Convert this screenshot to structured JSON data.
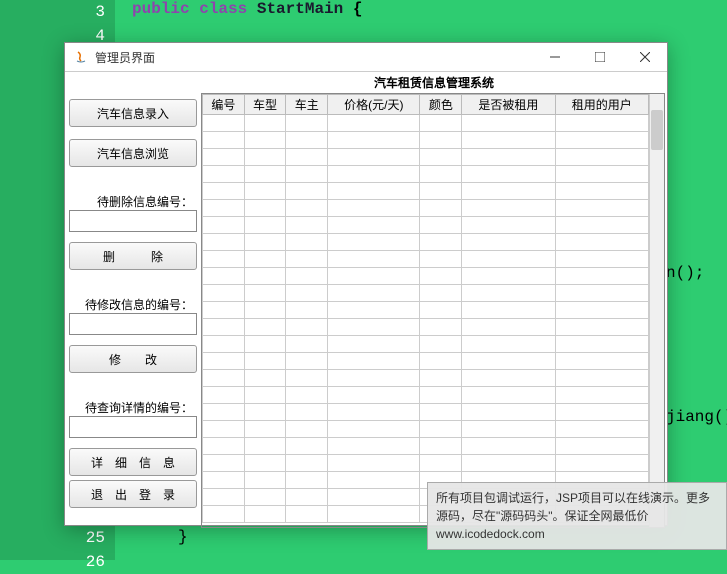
{
  "code": {
    "line_numbers": [
      "3",
      "4",
      "",
      "",
      "",
      "",
      "",
      "",
      "",
      "",
      "",
      "",
      "",
      "",
      "",
      "",
      "",
      "",
      "",
      "",
      "",
      "25",
      "26"
    ],
    "line3_kw1": "public",
    "line3_kw2": "class",
    "line3_name": "StartMain",
    "line3_brace": " {",
    "partial1": "n();",
    "partial2": "jiang();",
    "line_end": "}"
  },
  "window": {
    "title": "管理员界面"
  },
  "main": {
    "title": "汽车租赁信息管理系统"
  },
  "sidebar": {
    "btn_input": "汽车信息录入",
    "btn_browse": "汽车信息浏览",
    "label_delete": "待删除信息编号：",
    "btn_delete": "删　　　除",
    "label_modify": "待修改信息的编号：",
    "btn_modify": "修　　改",
    "label_detail": "待查询详情的编号：",
    "btn_detail": "详　细　信　息",
    "btn_logout": "退　出　登　录"
  },
  "table": {
    "headers": [
      "编号",
      "车型",
      "车主",
      "价格(元/天)",
      "颜色",
      "是否被租用",
      "租用的用户"
    ]
  },
  "watermark": {
    "text": "所有项目包调试运行，JSP项目可以在线演示。更多源码，尽在\"源码码头\"。保证全网最低价 www.icodedock.com"
  }
}
